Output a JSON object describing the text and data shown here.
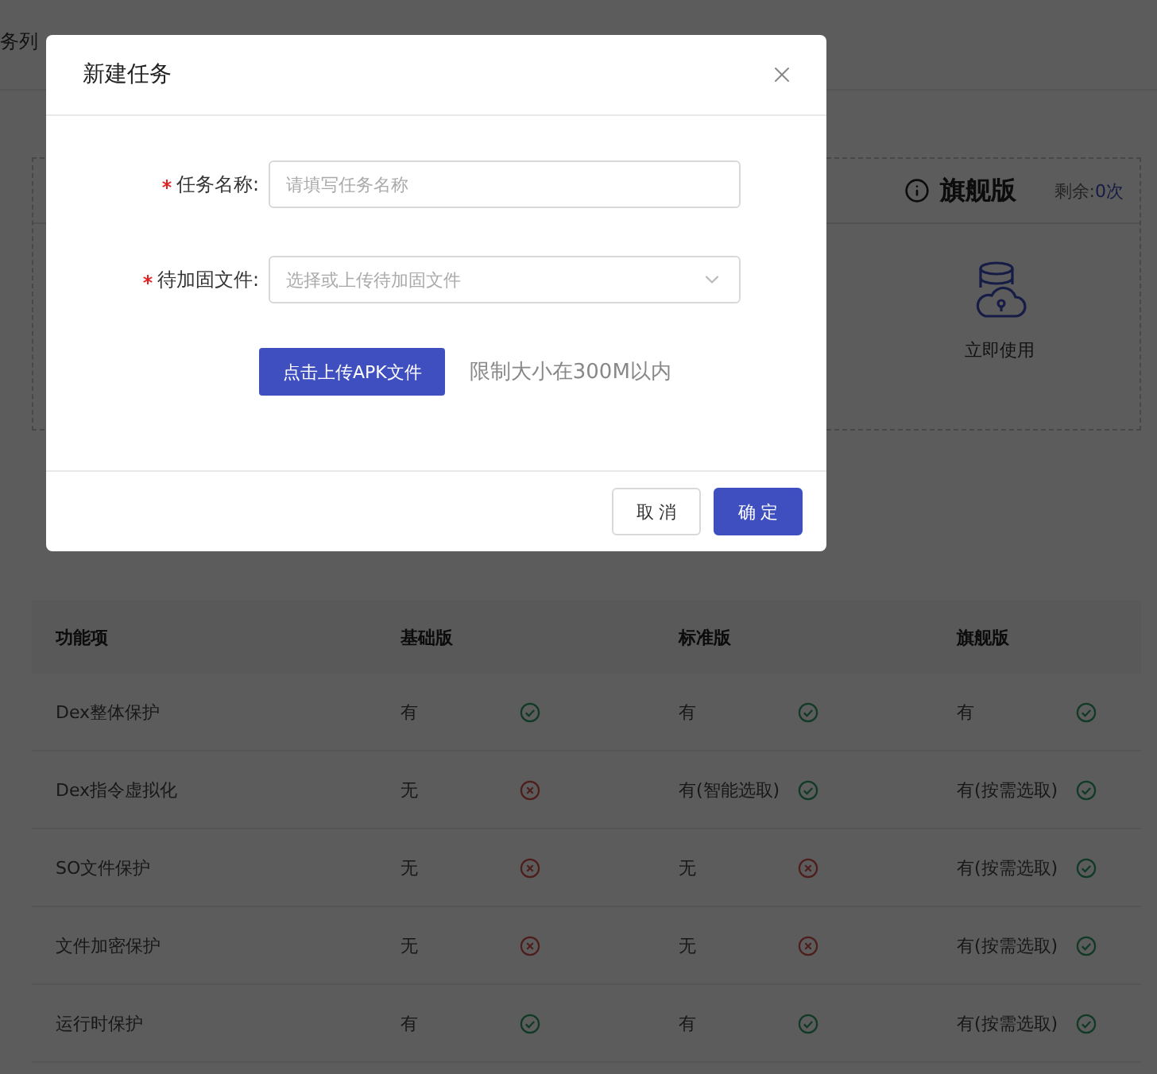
{
  "background": {
    "breadcrumb": "务列",
    "plan_panel": {
      "plan": "旗舰版",
      "remaining_label": "剩余:",
      "remaining_value": "0次",
      "action": "立即使用"
    },
    "comparison": {
      "header": {
        "feature_label": "功能项",
        "plans": [
          "基础版",
          "标准版",
          "旗舰版"
        ]
      },
      "features": [
        {
          "name": "Dex整体保护",
          "plans": [
            {
              "text": "有",
              "included": true
            },
            {
              "text": "有",
              "included": true
            },
            {
              "text": "有",
              "included": true
            }
          ]
        },
        {
          "name": "Dex指令虚拟化",
          "plans": [
            {
              "text": "无",
              "included": false
            },
            {
              "text": "有(智能选取)",
              "included": true
            },
            {
              "text": "有(按需选取)",
              "included": true
            }
          ]
        },
        {
          "name": "SO文件保护",
          "plans": [
            {
              "text": "无",
              "included": false
            },
            {
              "text": "无",
              "included": false
            },
            {
              "text": "有(按需选取)",
              "included": true
            }
          ]
        },
        {
          "name": "文件加密保护",
          "plans": [
            {
              "text": "无",
              "included": false
            },
            {
              "text": "无",
              "included": false
            },
            {
              "text": "有(按需选取)",
              "included": true
            }
          ]
        },
        {
          "name": "运行时保护",
          "plans": [
            {
              "text": "有",
              "included": true
            },
            {
              "text": "有",
              "included": true
            },
            {
              "text": "有(按需选取)",
              "included": true
            }
          ]
        }
      ]
    }
  },
  "dialog": {
    "title": "新建任务",
    "fields": [
      {
        "kind": "text",
        "label": "任务名称:",
        "required": true,
        "placeholder": "请填写任务名称"
      },
      {
        "kind": "select",
        "label": "待加固文件:",
        "required": true,
        "placeholder": "选择或上传待加固文件"
      }
    ],
    "upload": {
      "button": "点击上传APK文件",
      "hint": "限制大小在300M以内"
    },
    "buttons": [
      {
        "kind": "secondary",
        "label": "取 消"
      },
      {
        "kind": "primary",
        "label": "确 定"
      }
    ]
  }
}
